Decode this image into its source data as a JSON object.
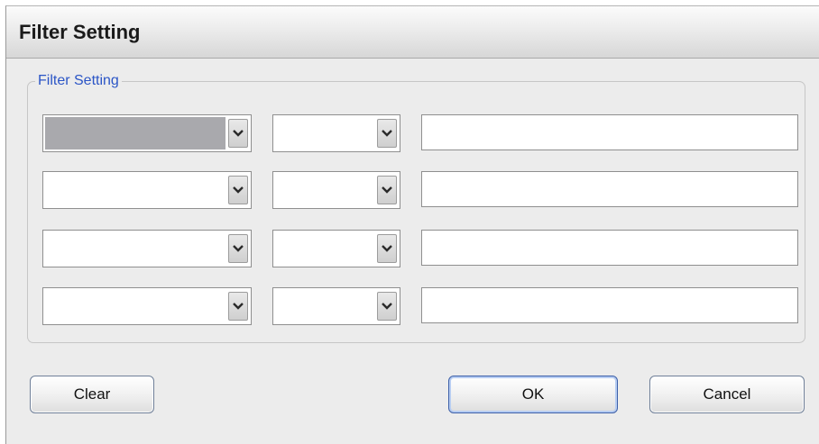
{
  "window": {
    "title": "Filter Setting"
  },
  "group": {
    "label": "Filter Setting"
  },
  "filter_rows": [
    {
      "field": "",
      "operator": "",
      "value": "",
      "field_selected": true
    },
    {
      "field": "",
      "operator": "",
      "value": "",
      "field_selected": false
    },
    {
      "field": "",
      "operator": "",
      "value": "",
      "field_selected": false
    },
    {
      "field": "",
      "operator": "",
      "value": "",
      "field_selected": false
    }
  ],
  "buttons": {
    "clear": "Clear",
    "ok": "OK",
    "cancel": "Cancel"
  },
  "icons": {
    "combo_arrow": "chevron-down-icon"
  },
  "colors": {
    "group_label": "#2b55c6",
    "selection_highlight": "#a9a9ad",
    "dialog_background": "#ececec"
  }
}
